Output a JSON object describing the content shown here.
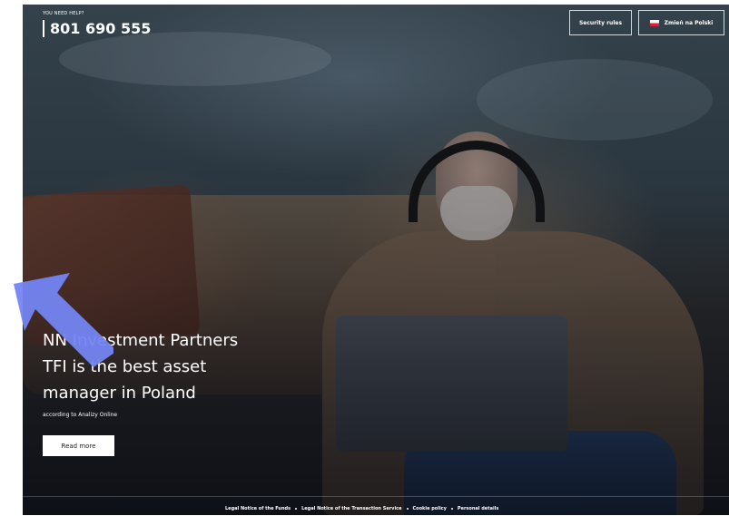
{
  "header": {
    "help_label": "YOU NEED HELP?",
    "phone": "801 690 555",
    "security_button": "Security rules",
    "language_button": "Zmień na Polski",
    "flag_icon": "poland-flag-icon"
  },
  "hero": {
    "headline_lines": [
      "NN Investment Partners",
      "TFI is the best asset",
      "manager in Poland"
    ],
    "subtitle": "according to Analizy Online",
    "cta": "Read more"
  },
  "footer": {
    "links": [
      "Legal Notice of the Funds",
      "Legal Notice of the Transaction Service",
      "Cookie policy",
      "Personal details"
    ]
  },
  "colors": {
    "text": "#ffffff",
    "cta_bg": "#ffffff",
    "pointer": "#7485f2"
  },
  "pointer_icon": "arrow-pointer-icon"
}
